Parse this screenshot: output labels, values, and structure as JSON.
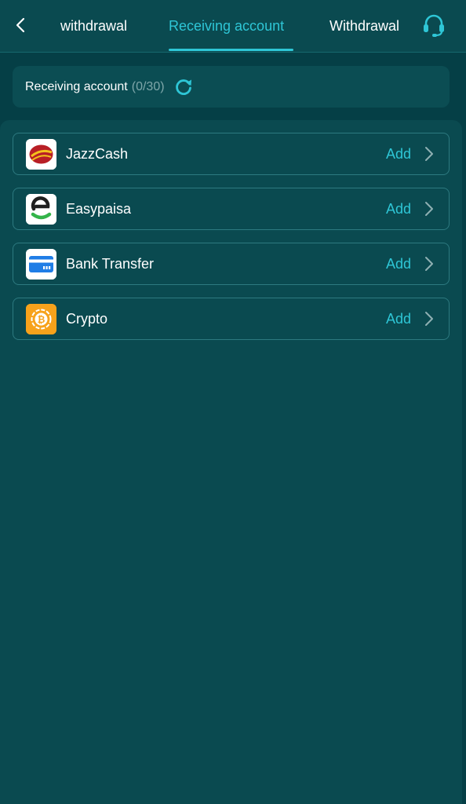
{
  "header": {
    "tabs": [
      {
        "label": "withdrawal"
      },
      {
        "label": "Receiving account"
      },
      {
        "label": "Withdrawal"
      }
    ],
    "active_tab": "Receiving account"
  },
  "summary": {
    "label": "Receiving account",
    "count": "(0/30)"
  },
  "methods": [
    {
      "name": "JazzCash",
      "action": "Add",
      "icon": "jazzcash-logo"
    },
    {
      "name": "Easypaisa",
      "action": "Add",
      "icon": "easypaisa-logo"
    },
    {
      "name": "Bank Transfer",
      "action": "Add",
      "icon": "bank-card-icon"
    },
    {
      "name": "Crypto",
      "action": "Add",
      "icon": "crypto-coin-icon"
    }
  ],
  "colors": {
    "background": "#053f46",
    "panel": "#0a4a50",
    "accent": "#2ec6d6",
    "muted": "#7fa7aa"
  }
}
